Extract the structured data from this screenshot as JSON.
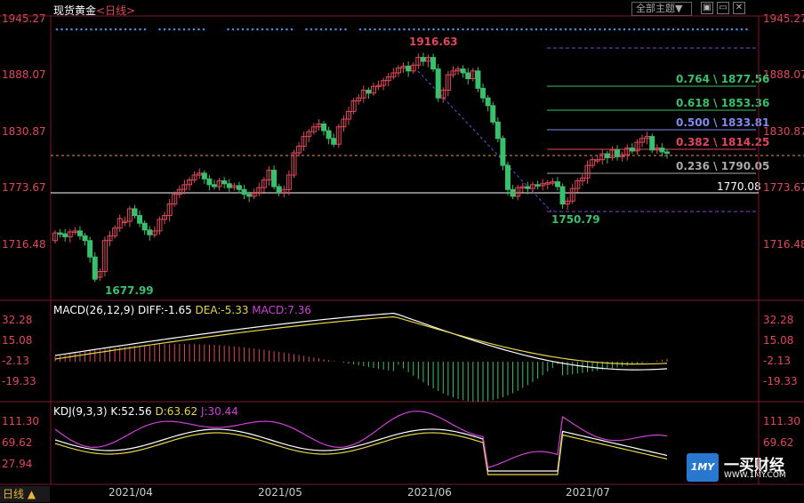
{
  "header": {
    "instrument": "现货黄金",
    "period_tag": "<日线>",
    "theme_button": "全部主题▼",
    "window_buttons": [
      "restore-icon",
      "minimize-icon",
      "close-icon"
    ]
  },
  "colors": {
    "up": "#e0485a",
    "down": "#39c06c",
    "bg": "#000000",
    "grid": "#7a1a2a"
  },
  "price_axis": {
    "labels": [
      "1945.27",
      "1888.07",
      "1830.87",
      "1773.67",
      "1716.48"
    ]
  },
  "macd_axis": {
    "labels": [
      "32.28",
      "15.08",
      "-2.13",
      "-19.33"
    ]
  },
  "kdj_axis": {
    "labels": [
      "111.30",
      "69.62",
      "27.94"
    ]
  },
  "macd_info": {
    "name": "MACD(26,12,9)",
    "diff": "DIFF:-1.65",
    "dea": "DEA:-5.33",
    "macd": "MACD:7.36"
  },
  "kdj_info": {
    "name": "KDJ(9,3,3)",
    "k": "K:52.56",
    "d": "D:63.62",
    "j": "J:30.44"
  },
  "annotations": {
    "high": "1916.63",
    "low1": "1677.99",
    "low2": "1750.79",
    "hline": "1770.08"
  },
  "fib_levels": [
    {
      "label": "0.764 \\ 1877.56",
      "color": "#39c06c"
    },
    {
      "label": "0.618 \\ 1853.36",
      "color": "#39c06c"
    },
    {
      "label": "0.500 \\ 1833.81",
      "color": "#7e8cf0"
    },
    {
      "label": "0.382 \\ 1814.25",
      "color": "#e0485a"
    },
    {
      "label": "0.236 \\ 1790.05",
      "color": "#aaaaaa"
    }
  ],
  "x_axis": {
    "labels": [
      "2021/04",
      "2021/05",
      "2021/06",
      "2021/07"
    ]
  },
  "period_button": "日线 ▲",
  "logo": {
    "mark": "1MY",
    "text": "一买财经",
    "url": "WWW.1MY.COM"
  },
  "chart_data": {
    "type": "candlestick",
    "price_ylim": [
      1660,
      1955
    ],
    "closes": [
      1730,
      1729,
      1726,
      1731,
      1732,
      1727,
      1722,
      1705,
      1682,
      1690,
      1722,
      1727,
      1735,
      1745,
      1742,
      1755,
      1748,
      1740,
      1733,
      1728,
      1732,
      1744,
      1748,
      1760,
      1770,
      1775,
      1780,
      1785,
      1790,
      1792,
      1786,
      1780,
      1778,
      1784,
      1781,
      1777,
      1779,
      1775,
      1770,
      1768,
      1772,
      1777,
      1785,
      1795,
      1778,
      1772,
      1775,
      1790,
      1813,
      1820,
      1830,
      1835,
      1840,
      1843,
      1836,
      1828,
      1822,
      1840,
      1848,
      1856,
      1867,
      1870,
      1878,
      1875,
      1882,
      1883,
      1888,
      1892,
      1896,
      1901,
      1903,
      1898,
      1904,
      1912,
      1908,
      1912,
      1900,
      1870,
      1878,
      1894,
      1898,
      1900,
      1896,
      1890,
      1898,
      1880,
      1870,
      1862,
      1845,
      1828,
      1800,
      1775,
      1768,
      1777,
      1778,
      1776,
      1780,
      1779,
      1781,
      1782,
      1783,
      1778,
      1760,
      1763,
      1776,
      1784,
      1787,
      1800,
      1806,
      1806,
      1812,
      1808,
      1816,
      1809,
      1811,
      1818,
      1815,
      1824,
      1828,
      1830,
      1816,
      1818,
      1814,
      1813
    ],
    "opens": [
      1722,
      1730,
      1729,
      1726,
      1731,
      1732,
      1727,
      1722,
      1705,
      1684,
      1690,
      1722,
      1727,
      1735,
      1742,
      1742,
      1755,
      1748,
      1740,
      1733,
      1728,
      1732,
      1744,
      1748,
      1760,
      1770,
      1775,
      1780,
      1785,
      1790,
      1792,
      1786,
      1780,
      1778,
      1784,
      1781,
      1777,
      1779,
      1775,
      1770,
      1768,
      1772,
      1777,
      1785,
      1795,
      1778,
      1772,
      1775,
      1790,
      1813,
      1820,
      1830,
      1835,
      1840,
      1843,
      1836,
      1828,
      1822,
      1840,
      1848,
      1856,
      1867,
      1870,
      1878,
      1875,
      1882,
      1883,
      1888,
      1892,
      1896,
      1901,
      1903,
      1898,
      1904,
      1912,
      1908,
      1912,
      1900,
      1870,
      1878,
      1894,
      1898,
      1900,
      1896,
      1890,
      1898,
      1880,
      1870,
      1862,
      1845,
      1828,
      1800,
      1775,
      1768,
      1777,
      1778,
      1776,
      1780,
      1779,
      1781,
      1782,
      1783,
      1778,
      1760,
      1763,
      1776,
      1784,
      1787,
      1800,
      1806,
      1806,
      1812,
      1808,
      1816,
      1809,
      1811,
      1818,
      1815,
      1824,
      1828,
      1830,
      1816,
      1818,
      1814
    ],
    "annotations": [
      {
        "label": "1916.63",
        "type": "high"
      },
      {
        "label": "1677.99",
        "type": "low"
      },
      {
        "label": "1750.79",
        "type": "low"
      },
      {
        "label": "1770.08",
        "type": "horizontal_line"
      }
    ]
  }
}
